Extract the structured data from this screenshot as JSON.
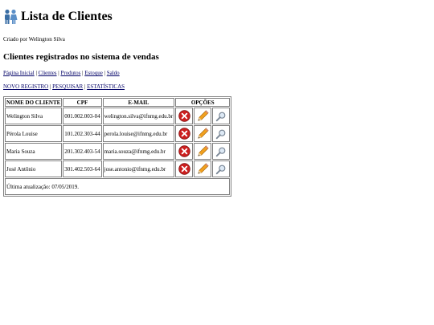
{
  "header": {
    "title": "Lista de Clientes",
    "credit": "Criado por Welington Silva"
  },
  "section_title": "Clientes registrados no sistema de vendas",
  "nav": [
    {
      "label": "Página Inicial"
    },
    {
      "label": "Clientes"
    },
    {
      "label": "Produtos"
    },
    {
      "label": "Estoque"
    },
    {
      "label": "Saldo"
    }
  ],
  "actions": [
    {
      "label": "NOVO REGISTRO"
    },
    {
      "label": "PESQUISAR"
    },
    {
      "label": "ESTATÍSTICAS"
    }
  ],
  "separator": "|",
  "table": {
    "headers": {
      "name": "NOME DO CLIENTE",
      "cpf": "CPF",
      "email": "E-MAIL",
      "options": "OPÇÕES"
    },
    "rows": [
      {
        "name": "Welington Silva",
        "cpf": "001.002.003-04",
        "email": "welington.silva@ifnmg.edu.br"
      },
      {
        "name": "Pérola Louise",
        "cpf": "101.202.303-44",
        "email": "perola.louise@ifnmg.edu.br"
      },
      {
        "name": "Maria Souza",
        "cpf": "201.302.403-54",
        "email": "maria.souza@ifnmg.edu.br"
      },
      {
        "name": "José Antônio",
        "cpf": "301.402.503-64",
        "email": "jose.antonio@ifnmg.edu.br"
      }
    ],
    "footer": "Última atualização: 07/05/2019."
  },
  "icons": {
    "title": "people-icon",
    "delete": "delete-icon",
    "edit": "pencil-icon",
    "view": "magnifier-icon"
  },
  "colors": {
    "link": "#000066",
    "delete": "#cc1f1f",
    "pencil": "#f2a11f"
  }
}
